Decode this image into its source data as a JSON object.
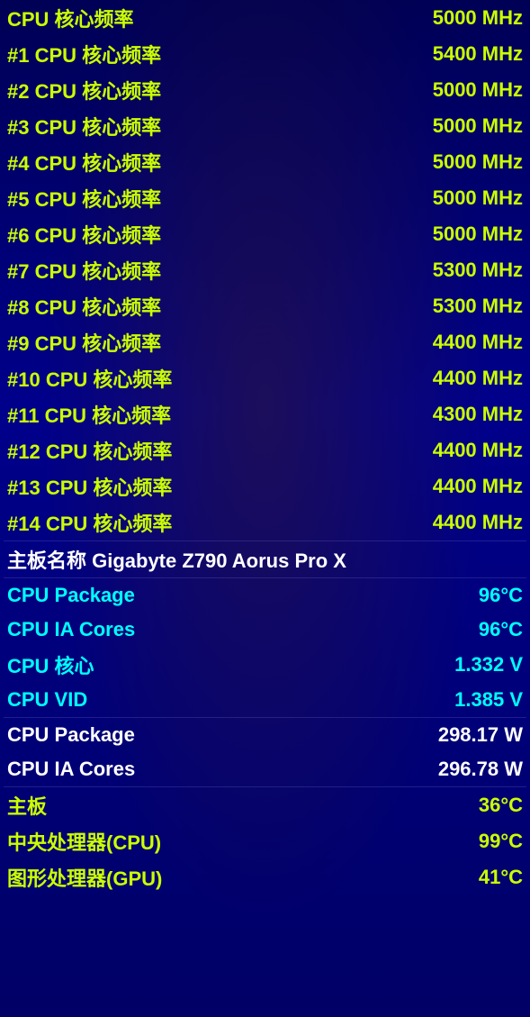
{
  "rows": [
    {
      "id": "cpu-core-freq",
      "label": "CPU 核心频率",
      "value": "5000 MHz",
      "style": "yellow"
    },
    {
      "id": "cpu-core-freq-1",
      "label": "#1 CPU 核心频率",
      "value": "5400 MHz",
      "style": "yellow"
    },
    {
      "id": "cpu-core-freq-2",
      "label": "#2 CPU 核心频率",
      "value": "5000 MHz",
      "style": "yellow"
    },
    {
      "id": "cpu-core-freq-3",
      "label": "#3 CPU 核心频率",
      "value": "5000 MHz",
      "style": "yellow"
    },
    {
      "id": "cpu-core-freq-4",
      "label": "#4 CPU 核心频率",
      "value": "5000 MHz",
      "style": "yellow"
    },
    {
      "id": "cpu-core-freq-5",
      "label": "#5 CPU 核心频率",
      "value": "5000 MHz",
      "style": "yellow"
    },
    {
      "id": "cpu-core-freq-6",
      "label": "#6 CPU 核心频率",
      "value": "5000 MHz",
      "style": "yellow"
    },
    {
      "id": "cpu-core-freq-7",
      "label": "#7 CPU 核心频率",
      "value": "5300 MHz",
      "style": "yellow"
    },
    {
      "id": "cpu-core-freq-8",
      "label": "#8 CPU 核心频率",
      "value": "5300 MHz",
      "style": "yellow"
    },
    {
      "id": "cpu-core-freq-9",
      "label": "#9 CPU 核心频率",
      "value": "4400 MHz",
      "style": "yellow"
    },
    {
      "id": "cpu-core-freq-10",
      "label": "#10 CPU 核心频率",
      "value": "4400 MHz",
      "style": "yellow"
    },
    {
      "id": "cpu-core-freq-11",
      "label": "#11 CPU 核心频率",
      "value": "4300 MHz",
      "style": "yellow"
    },
    {
      "id": "cpu-core-freq-12",
      "label": "#12 CPU 核心频率",
      "value": "4400 MHz",
      "style": "yellow"
    },
    {
      "id": "cpu-core-freq-13",
      "label": "#13 CPU 核心频率",
      "value": "4400 MHz",
      "style": "yellow"
    },
    {
      "id": "cpu-core-freq-14",
      "label": "#14 CPU 核心频率",
      "value": "4400 MHz",
      "style": "yellow"
    },
    {
      "id": "motherboard-name",
      "label": "主板名称   Gigabyte Z790 Aorus Pro X",
      "value": "",
      "style": "white"
    },
    {
      "id": "cpu-package-temp",
      "label": "CPU Package",
      "value": "96°C",
      "style": "cyan"
    },
    {
      "id": "cpu-ia-cores-temp",
      "label": "CPU IA Cores",
      "value": "96°C",
      "style": "cyan"
    },
    {
      "id": "cpu-core-voltage",
      "label": "CPU 核心",
      "value": "1.332 V",
      "style": "cyan"
    },
    {
      "id": "cpu-vid",
      "label": "CPU VID",
      "value": "1.385 V",
      "style": "cyan"
    },
    {
      "id": "cpu-package-power",
      "label": "CPU Package",
      "value": "298.17 W",
      "style": "white"
    },
    {
      "id": "cpu-ia-cores-power",
      "label": "CPU IA Cores",
      "value": "296.78 W",
      "style": "white"
    },
    {
      "id": "board-temp",
      "label": "主板",
      "value": "36°C",
      "style": "yellow"
    },
    {
      "id": "cpu-temp",
      "label": "中央处理器(CPU)",
      "value": "99°C",
      "style": "yellow"
    },
    {
      "id": "gpu-temp",
      "label": "图形处理器(GPU)",
      "value": "41°C",
      "style": "yellow"
    }
  ]
}
